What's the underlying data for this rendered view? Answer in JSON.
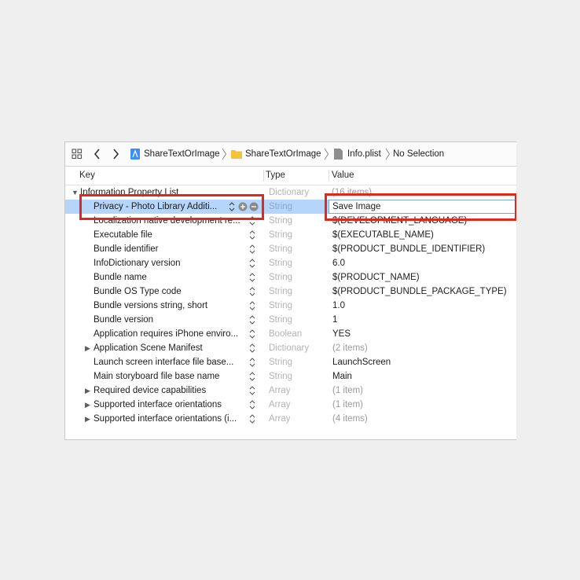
{
  "breadcrumb": {
    "project": "ShareTextOrImage",
    "group": "ShareTextOrImage",
    "file": "Info.plist",
    "selection": "No Selection"
  },
  "columns": {
    "key": "Key",
    "type": "Type",
    "value": "Value"
  },
  "rows": [
    {
      "key": "Information Property List",
      "type": "Dictionary",
      "value": "(16 items)"
    },
    {
      "key": "Privacy - Photo Library Additi...",
      "type": "String",
      "value": "Save Image"
    },
    {
      "key": "Localization native development re...",
      "type": "String",
      "value": "$(DEVELOPMENT_LANGUAGE)"
    },
    {
      "key": "Executable file",
      "type": "String",
      "value": "$(EXECUTABLE_NAME)"
    },
    {
      "key": "Bundle identifier",
      "type": "String",
      "value": "$(PRODUCT_BUNDLE_IDENTIFIER)"
    },
    {
      "key": "InfoDictionary version",
      "type": "String",
      "value": "6.0"
    },
    {
      "key": "Bundle name",
      "type": "String",
      "value": "$(PRODUCT_NAME)"
    },
    {
      "key": "Bundle OS Type code",
      "type": "String",
      "value": "$(PRODUCT_BUNDLE_PACKAGE_TYPE)"
    },
    {
      "key": "Bundle versions string, short",
      "type": "String",
      "value": "1.0"
    },
    {
      "key": "Bundle version",
      "type": "String",
      "value": "1"
    },
    {
      "key": "Application requires iPhone enviro...",
      "type": "Boolean",
      "value": "YES"
    },
    {
      "key": "Application Scene Manifest",
      "type": "Dictionary",
      "value": "(2 items)"
    },
    {
      "key": "Launch screen interface file base...",
      "type": "String",
      "value": "LaunchScreen"
    },
    {
      "key": "Main storyboard file base name",
      "type": "String",
      "value": "Main"
    },
    {
      "key": "Required device capabilities",
      "type": "Array",
      "value": "(1 item)"
    },
    {
      "key": "Supported interface orientations",
      "type": "Array",
      "value": "(1 item)"
    },
    {
      "key": "Supported interface orientations (i...",
      "type": "Array",
      "value": "(4 items)"
    }
  ],
  "colors": {
    "selection": "#b5d5fb",
    "highlight": "#e0281e"
  }
}
